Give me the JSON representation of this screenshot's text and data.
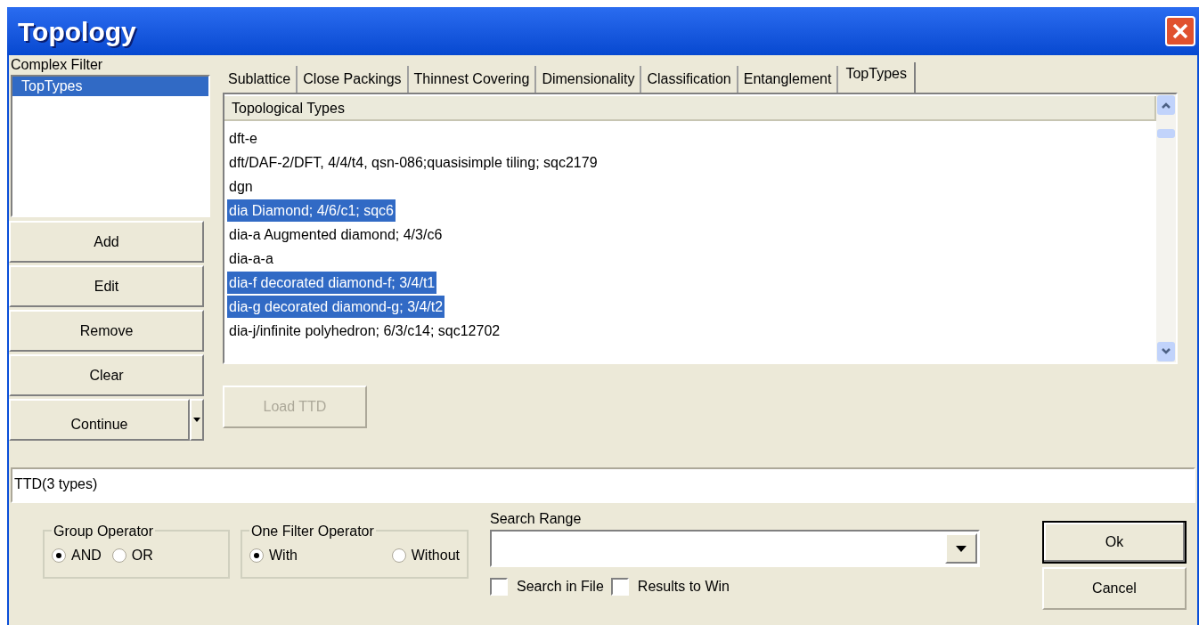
{
  "window": {
    "title": "Topology"
  },
  "complex_filter": {
    "label": "Complex Filter",
    "items": [
      {
        "label": "TopTypes",
        "selected": true
      }
    ]
  },
  "filter_buttons": [
    {
      "label": "Add",
      "kind": "plain"
    },
    {
      "label": "Edit",
      "kind": "plain"
    },
    {
      "label": "Remove",
      "kind": "plain"
    },
    {
      "label": "Clear",
      "kind": "plain"
    },
    {
      "label": "Continue",
      "kind": "split"
    }
  ],
  "tabs": [
    {
      "label": "Sublattice",
      "selected": false
    },
    {
      "label": "Close Packings",
      "selected": false
    },
    {
      "label": "Thinnest Covering",
      "selected": false
    },
    {
      "label": "Dimensionality",
      "selected": false
    },
    {
      "label": "Classification",
      "selected": false
    },
    {
      "label": "Entanglement",
      "selected": false
    },
    {
      "label": "TopTypes",
      "selected": true
    }
  ],
  "types_list": {
    "column": "Topological Types",
    "rows": [
      {
        "text": "dft-e",
        "selected": false
      },
      {
        "text": "dft/DAF-2/DFT, 4/4/t4, qsn-086;quasisimple tiling; sqc2179",
        "selected": false
      },
      {
        "text": "dgn",
        "selected": false
      },
      {
        "text": "dia Diamond; 4/6/c1; sqc6",
        "selected": true
      },
      {
        "text": "dia-a Augmented diamond; 4/3/c6",
        "selected": false
      },
      {
        "text": "dia-a-a",
        "selected": false
      },
      {
        "text": "dia-f decorated diamond-f; 3/4/t1",
        "selected": true
      },
      {
        "text": "dia-g decorated diamond-g; 3/4/t2",
        "selected": true
      },
      {
        "text": "dia-j/infinite polyhedron; 6/3/c14; sqc12702",
        "selected": false
      }
    ]
  },
  "load_button": {
    "label": "Load TTD",
    "disabled": true
  },
  "status_field": {
    "value": "TTD(3 types)"
  },
  "group_operator": {
    "title": "Group Operator",
    "options": [
      {
        "label": "AND",
        "selected": true
      },
      {
        "label": "OR",
        "selected": false
      }
    ]
  },
  "one_filter_operator": {
    "title": "One Filter Operator",
    "options": [
      {
        "label": "With",
        "selected": true
      },
      {
        "label": "Without",
        "selected": false
      }
    ]
  },
  "search_range": {
    "label": "Search Range"
  },
  "checkboxes": [
    {
      "label": "Search in File",
      "checked": false
    },
    {
      "label": "Results to Win",
      "checked": false
    }
  ],
  "dialog_buttons": [
    {
      "label": "Ok",
      "default": true
    },
    {
      "label": "Cancel",
      "default": false
    }
  ]
}
